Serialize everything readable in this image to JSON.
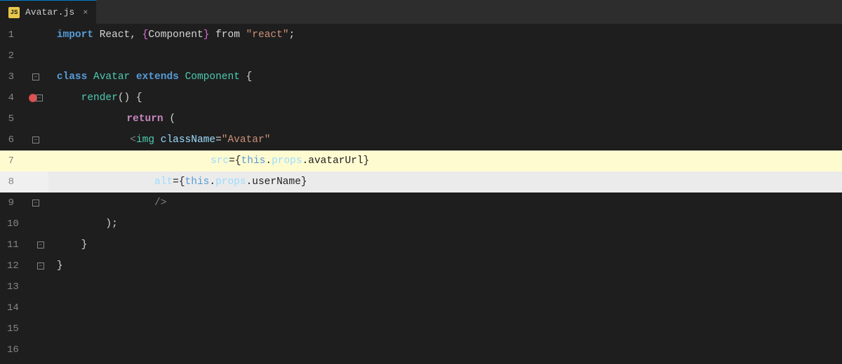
{
  "tab": {
    "icon_text": "JS",
    "label": "Avatar.js",
    "close_label": "×"
  },
  "colors": {
    "bg": "#1e1e1e",
    "tab_bg": "#2d2d2d",
    "line_num": "#858585",
    "highlight_line": "#fffbd1",
    "subtle_line": "#f0f0f0"
  },
  "lines": [
    {
      "num": 1,
      "has_fold": false,
      "has_breakpoint": false,
      "has_debug": false
    },
    {
      "num": 2,
      "has_fold": false,
      "has_breakpoint": false,
      "has_debug": false
    },
    {
      "num": 3,
      "has_fold": true,
      "has_breakpoint": false,
      "has_debug": false
    },
    {
      "num": 4,
      "has_fold": true,
      "has_breakpoint": true,
      "has_debug": true
    },
    {
      "num": 5,
      "has_fold": false,
      "has_breakpoint": false,
      "has_debug": false
    },
    {
      "num": 6,
      "has_fold": true,
      "has_breakpoint": false,
      "has_debug": false
    },
    {
      "num": 7,
      "has_fold": false,
      "has_breakpoint": false,
      "has_debug": false
    },
    {
      "num": 8,
      "has_fold": false,
      "has_breakpoint": false,
      "has_debug": false
    },
    {
      "num": 9,
      "has_fold": true,
      "has_breakpoint": false,
      "has_debug": false
    },
    {
      "num": 10,
      "has_fold": false,
      "has_breakpoint": false,
      "has_debug": false
    },
    {
      "num": 11,
      "has_fold": true,
      "has_breakpoint": false,
      "has_debug": false
    },
    {
      "num": 12,
      "has_fold": true,
      "has_breakpoint": false,
      "has_debug": false
    },
    {
      "num": 13,
      "has_fold": false,
      "has_breakpoint": false,
      "has_debug": false
    },
    {
      "num": 14,
      "has_fold": false,
      "has_breakpoint": false,
      "has_debug": false
    },
    {
      "num": 15,
      "has_fold": false,
      "has_breakpoint": false,
      "has_debug": false
    },
    {
      "num": 16,
      "has_fold": false,
      "has_breakpoint": false,
      "has_debug": false
    }
  ]
}
